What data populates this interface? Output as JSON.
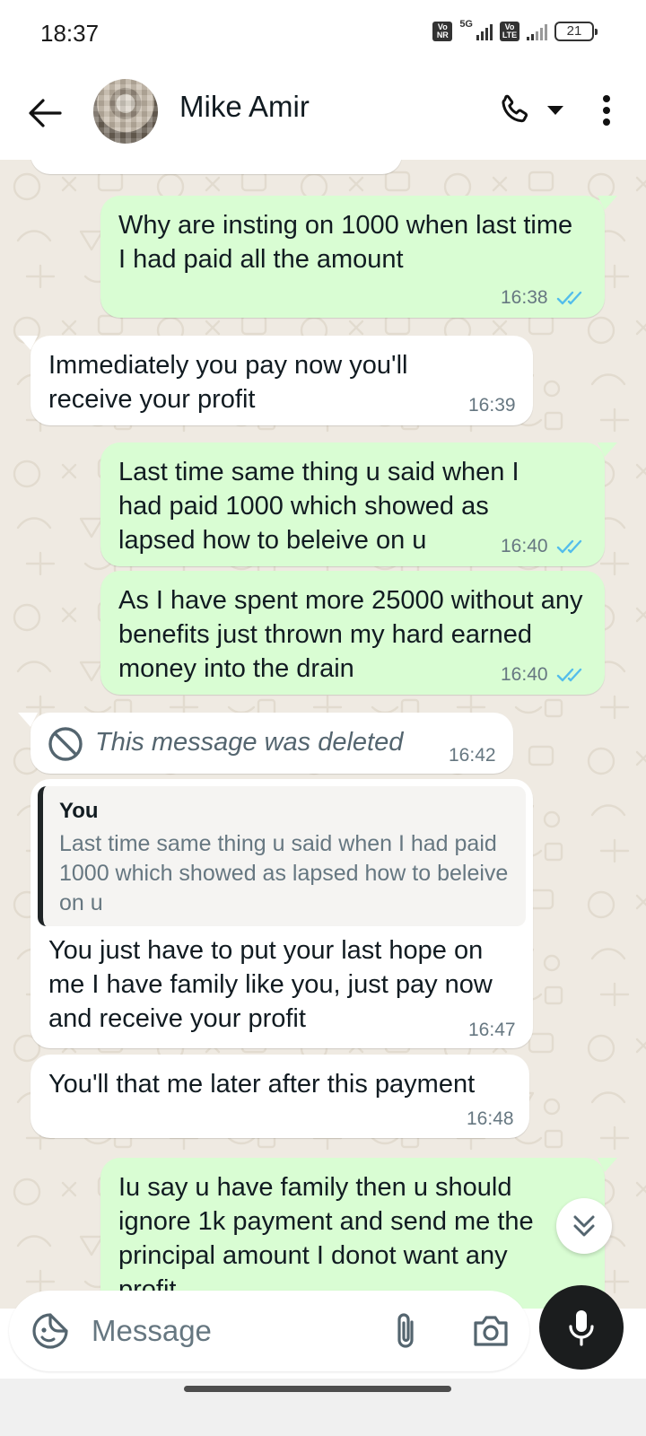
{
  "status_bar": {
    "time": "18:37",
    "network_label": "5G",
    "sim_tag_1": "Vo NR",
    "sim_tag_2": "Vo LTE",
    "battery": "21"
  },
  "header": {
    "contact_name": "Mike Amir",
    "icons": [
      "back-arrow-icon",
      "call-icon",
      "dropdown-icon",
      "more-vert-icon"
    ]
  },
  "messages": [
    {
      "direction": "out",
      "text": "Why are insting on 1000 when last time I had paid all the amount",
      "time": "16:38",
      "status": "read"
    },
    {
      "direction": "in",
      "text": "Immediately you pay now you'll receive your profit",
      "time": "16:39"
    },
    {
      "direction": "out",
      "text": "Last time same thing u said when I had paid 1000 which showed as lapsed how to beleive on u",
      "time": "16:40",
      "status": "read"
    },
    {
      "direction": "out",
      "text": "As I have spent more 25000 without any benefits just thrown my hard earned money into the drain",
      "time": "16:40",
      "status": "read"
    },
    {
      "direction": "in",
      "deleted": true,
      "text": "This message was deleted",
      "time": "16:42"
    },
    {
      "direction": "in",
      "quote": {
        "author": "You",
        "text": "Last time same thing u said when I had paid 1000 which showed as lapsed how to beleive on u"
      },
      "text": "You just have to put your last hope on me I have family like you, just pay now and receive your profit",
      "time": "16:47"
    },
    {
      "direction": "in",
      "text": "You'll that me later after this payment",
      "time": "16:48"
    },
    {
      "direction": "out",
      "text": "Iu say u have family then u should ignore 1k payment and send me the principal amount I donot want any profit"
    }
  ],
  "composer": {
    "placeholder": "Message",
    "icons": [
      "sticker-icon",
      "attach-icon",
      "camera-icon",
      "mic-icon"
    ]
  },
  "colors": {
    "outgoing_bubble": "#d9fdd3",
    "incoming_bubble": "#ffffff",
    "chat_background": "#efeae2",
    "read_ticks": "#53bdeb"
  }
}
